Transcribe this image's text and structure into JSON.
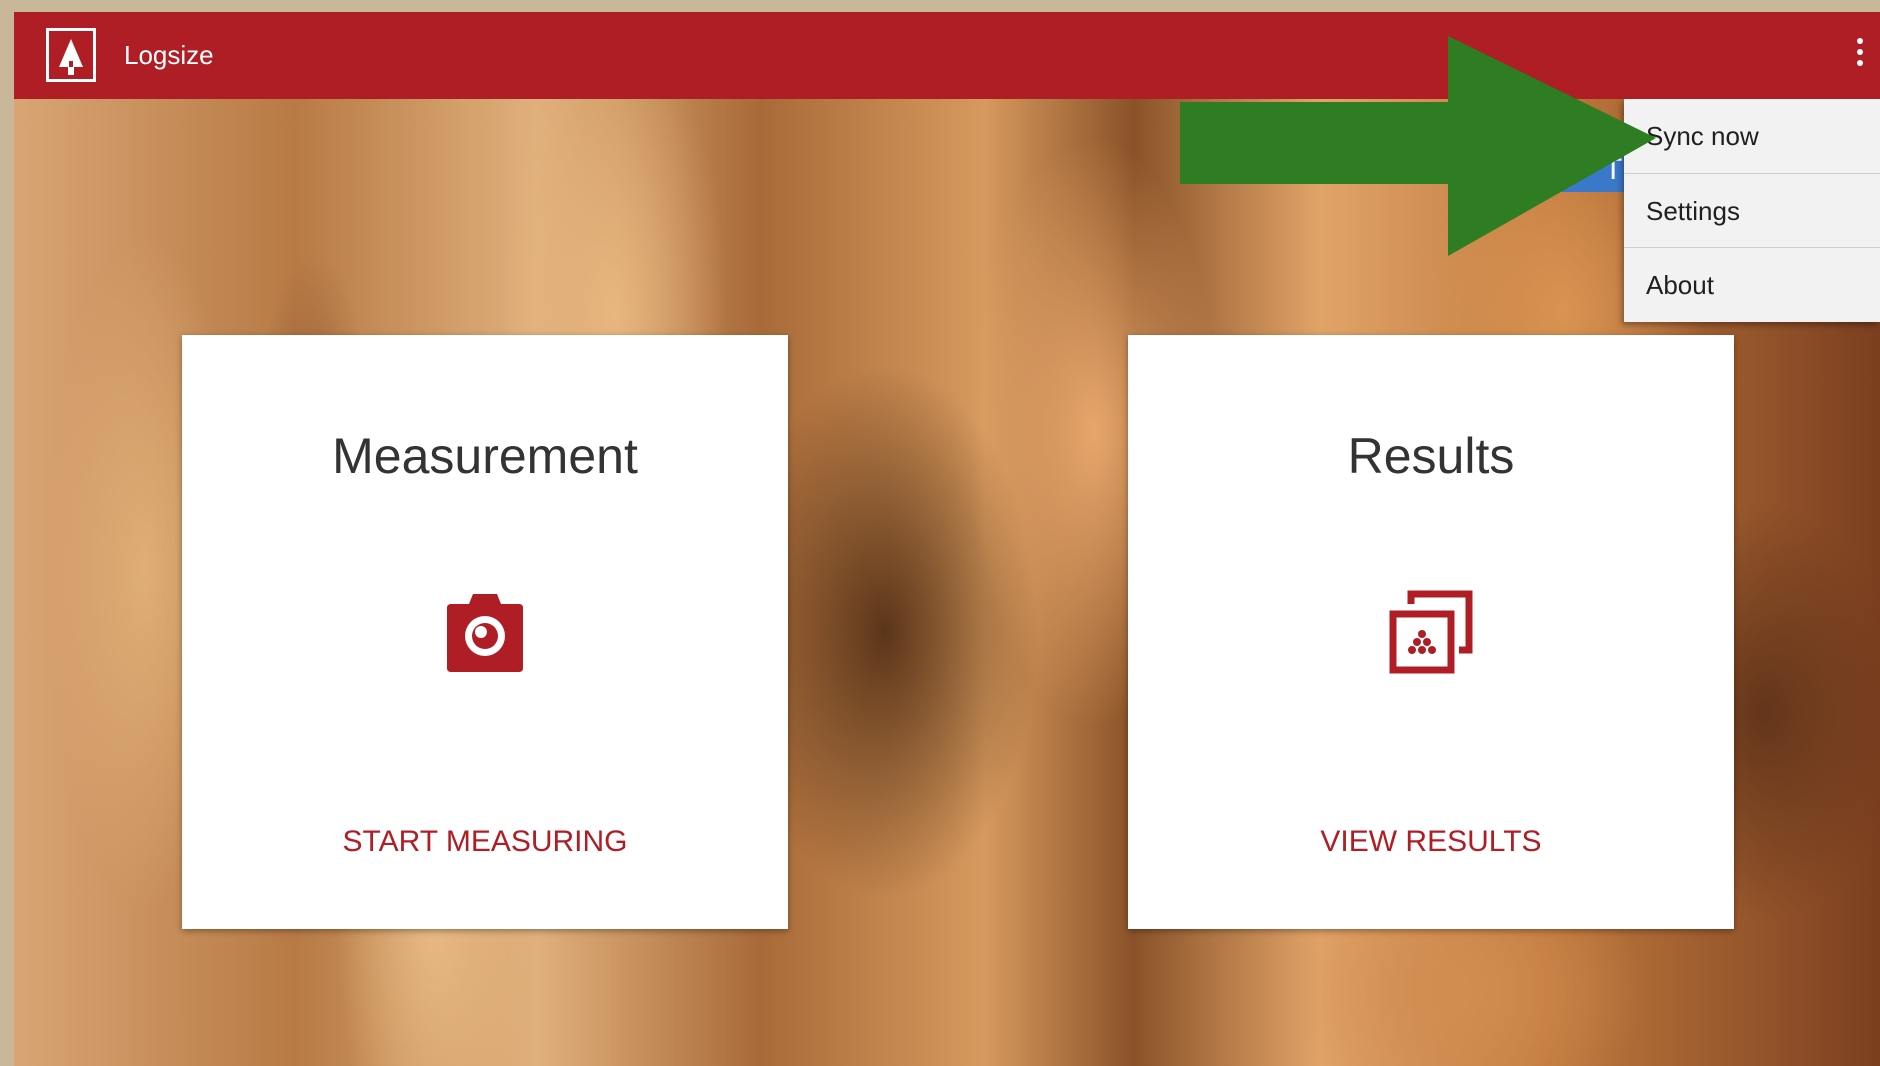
{
  "app_bar": {
    "title": "Logsize",
    "color": "#b01e25"
  },
  "background": {
    "description_icon": "stacked-logs-photo"
  },
  "cards": [
    {
      "title": "Measurement",
      "icon": "camera-icon",
      "action_label": "START MEASURING"
    },
    {
      "title": "Results",
      "icon": "gallery-icon",
      "action_label": "VIEW RESULTS"
    }
  ],
  "overflow_menu": {
    "items": [
      {
        "label": "Sync now"
      },
      {
        "label": "Settings"
      },
      {
        "label": "About"
      }
    ]
  },
  "annotation": {
    "icon": "green-arrow-icon",
    "color": "#2e7d22"
  },
  "accent_color": "#b01e25"
}
